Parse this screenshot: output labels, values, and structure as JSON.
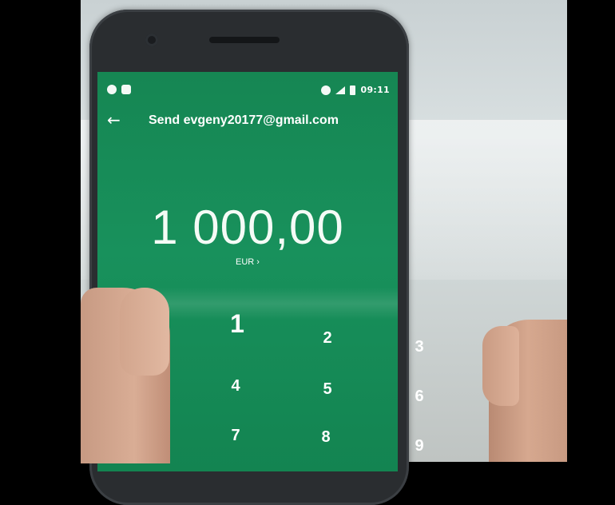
{
  "status_bar": {
    "time": "09:11",
    "left_icons": [
      "chat-bubble-icon",
      "bus-icon"
    ],
    "right_icons": [
      "do-not-disturb-icon",
      "signal-icon",
      "battery-icon"
    ]
  },
  "app_bar": {
    "back_icon": "arrow-left-icon",
    "title": "Send evgeny20177@gmail.com"
  },
  "amount": {
    "value": "1 000,00",
    "currency_label": "EUR ›"
  },
  "keypad": {
    "keys": [
      "1",
      "2",
      "3",
      "4",
      "5",
      "6",
      "7",
      "8",
      "9"
    ]
  },
  "colors": {
    "screen_green": "#18915c",
    "text": "#ffffff"
  }
}
